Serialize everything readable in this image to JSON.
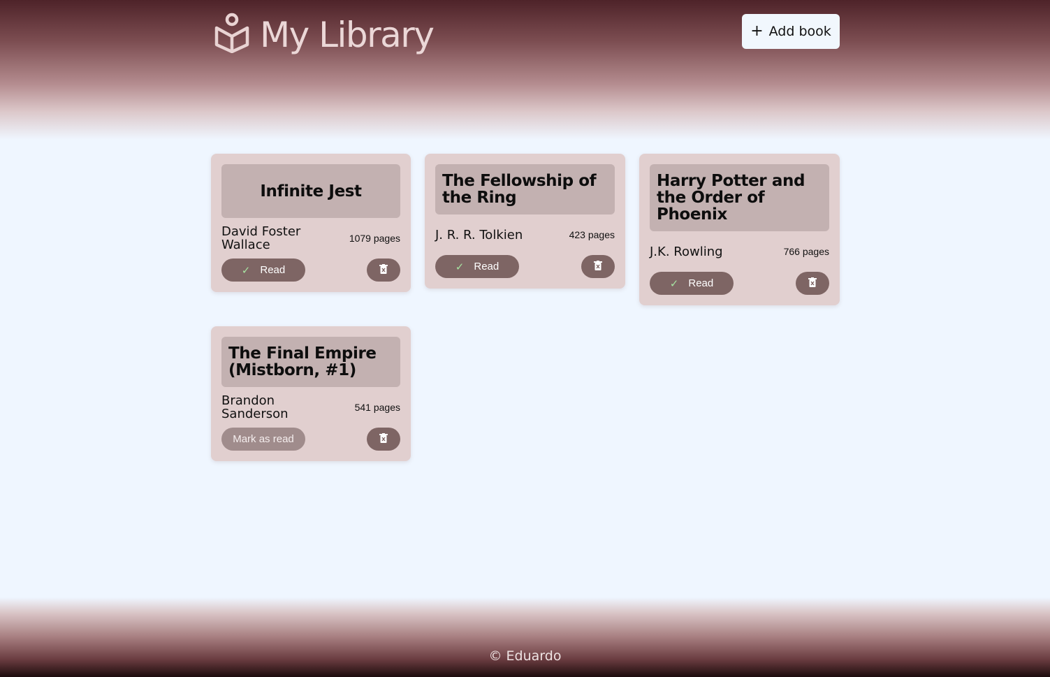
{
  "header": {
    "title": "My Library",
    "add_button_label": "Add book",
    "add_button_icon": "plus-icon",
    "logo_icon": "open-book-reader-icon"
  },
  "books": [
    {
      "title": "Infinite Jest",
      "author": "David Foster Wallace",
      "pages": "1079 pages",
      "status_label": "Read",
      "read": true
    },
    {
      "title": "The Fellowship of the Ring",
      "author": "J. R. R. Tolkien",
      "pages": "423 pages",
      "status_label": "Read",
      "read": true
    },
    {
      "title": "Harry Potter and the Order of Phoenix",
      "author": "J.K. Rowling",
      "pages": "766 pages",
      "status_label": "Read",
      "read": true
    },
    {
      "title": "The Final Empire (Mistborn, #1)",
      "author": "Brandon Sanderson",
      "pages": "541 pages",
      "status_label": "Mark as read",
      "read": false
    }
  ],
  "footer": {
    "copyright": "© Eduardo"
  },
  "colors": {
    "accent": "#7e6564",
    "card_bg": "#e1cfcf",
    "title_bg": "#c3b1b1",
    "page_bg": "#eff6ff",
    "header_dark": "#4e2329"
  }
}
